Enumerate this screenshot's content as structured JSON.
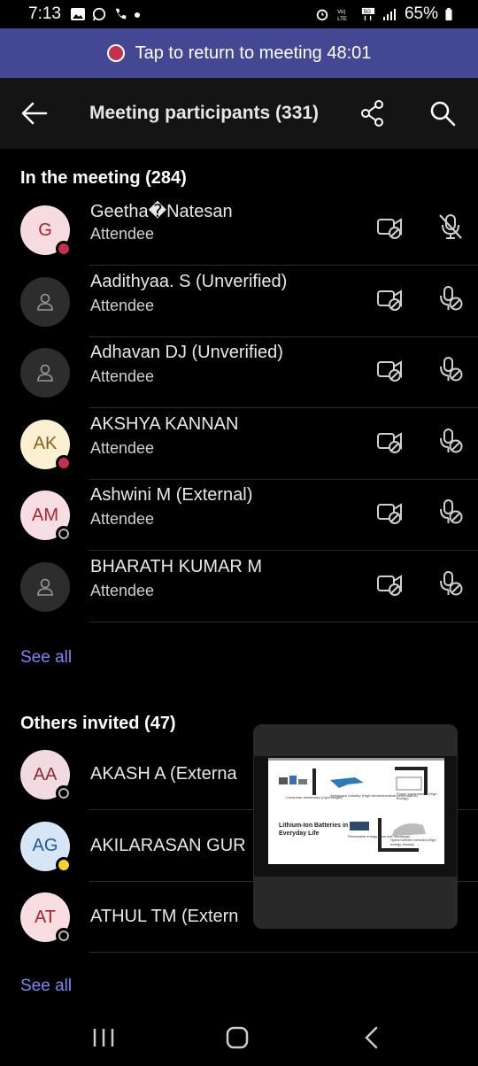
{
  "status": {
    "time": "7:13",
    "battery": "65%"
  },
  "banner": {
    "text": "Tap to return to meeting 48:01"
  },
  "header": {
    "title": "Meeting participants (331)"
  },
  "in_meeting": {
    "title": "In the meeting (284)",
    "participants": [
      {
        "initials": "G",
        "name": "Geetha�Natesan",
        "role": "Attendee",
        "avatar_bg": "#f6dbe0",
        "avatar_fg": "#a4262c",
        "badge": "red"
      },
      {
        "initials": "",
        "name": "Aadithyaa. S (Unverified)",
        "role": "Attendee",
        "avatar_bg": "#2d2d2d",
        "avatar_fg": "#999999",
        "badge": ""
      },
      {
        "initials": "",
        "name": "Adhavan DJ  (Unverified)",
        "role": "Attendee",
        "avatar_bg": "#2d2d2d",
        "avatar_fg": "#999999",
        "badge": ""
      },
      {
        "initials": "AK",
        "name": "AKSHYA  KANNAN",
        "role": "Attendee",
        "avatar_bg": "#fbf0d1",
        "avatar_fg": "#8a6116",
        "badge": "red"
      },
      {
        "initials": "AM",
        "name": "Ashwini M (External)",
        "role": "Attendee",
        "avatar_bg": "#f9dde4",
        "avatar_fg": "#a4262c",
        "badge": "off"
      },
      {
        "initials": "",
        "name": "BHARATH KUMAR M",
        "role": "Attendee",
        "avatar_bg": "#2d2d2d",
        "avatar_fg": "#999999",
        "badge": ""
      }
    ],
    "see_all": "See all"
  },
  "others": {
    "title": "Others invited (47)",
    "participants": [
      {
        "initials": "AA",
        "name": "AKASH A (Externa",
        "avatar_bg": "#f2dbe0",
        "avatar_fg": "#8e2a36",
        "badge": "off"
      },
      {
        "initials": "AG",
        "name": "AKILARASAN  GUR",
        "avatar_bg": "#d6e6f7",
        "avatar_fg": "#1b5a94",
        "badge": "away"
      },
      {
        "initials": "AT",
        "name": "ATHUL TM (Extern",
        "avatar_bg": "#f9dde0",
        "avatar_fg": "#a4262c",
        "badge": "off"
      }
    ],
    "see_all": "See all"
  },
  "pip": {
    "slide_title": "Lithium-Ion Batteries in Everyday Life",
    "labels": [
      "Consumer electronics (Light weight)",
      "Aerospace Industry (High electrochemical performance)",
      "Power transmission (High energy)",
      "Renewable energy (Low self discharge)",
      "Hybrid electric vehicles (High energy density)"
    ]
  },
  "colors": {
    "accent": "#7f85f5",
    "banner": "#444791",
    "red": "#c4314b"
  }
}
